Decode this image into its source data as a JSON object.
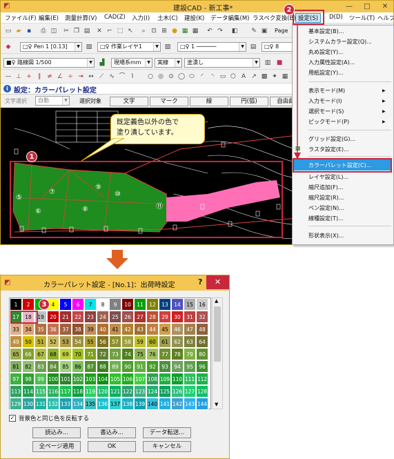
{
  "app": {
    "title": "建設CAD - 新工事*",
    "controls": [
      "—",
      "□",
      "✕"
    ]
  },
  "menu": [
    {
      "label": "ファイル(F)",
      "name": "menu-file"
    },
    {
      "label": "編集(E)",
      "name": "menu-edit"
    },
    {
      "label": "測量計算(V)",
      "name": "menu-survey"
    },
    {
      "label": "CAD(Z)",
      "name": "menu-cad"
    },
    {
      "label": "入力(I)",
      "name": "menu-input"
    },
    {
      "label": "土木(C)",
      "name": "menu-civil"
    },
    {
      "label": "建設(K)",
      "name": "menu-construction"
    },
    {
      "label": "データ編集(M)",
      "name": "menu-data-edit"
    },
    {
      "label": "ラスベク変換(B)",
      "name": "menu-raster"
    },
    {
      "label": "設定(S)",
      "name": "menu-settings"
    },
    {
      "label": "D(D)",
      "name": "menu-d"
    },
    {
      "label": "ツール(T)",
      "name": "menu-tools"
    },
    {
      "label": "ヘルプ",
      "name": "menu-help"
    }
  ],
  "toolbar": {
    "page_label": "Page",
    "pen_combo": "Pen 1 [0.13]",
    "layer_combo": "作業レイヤ1",
    "line_combo": "1 ──────",
    "num_combo": "8",
    "sheet_combo": "路線図 1/500",
    "scale_combo": "現場系mm",
    "mode_combo": "実線",
    "fill_combo": "塗潰し"
  },
  "command": {
    "title": "設定：カラーパレット設定",
    "text_select_label": "文字選択",
    "auto_label": "自動",
    "target_label": "選択対象",
    "buttons": [
      "文字",
      "マーク",
      "線",
      "円(弧)",
      "自由曲"
    ]
  },
  "settings_menu": {
    "items": [
      {
        "label": "基本設定(B)...",
        "arrow": false
      },
      {
        "label": "システムカラー設定(Q)...",
        "arrow": false
      },
      {
        "label": "丸め設定(Y)...",
        "arrow": false
      },
      {
        "label": "入力属性設定(A)...",
        "arrow": false
      },
      {
        "label": "用紙設定(Y)...",
        "arrow": false
      },
      {
        "label": "表示モード(M)",
        "arrow": true
      },
      {
        "label": "入力モード(I)",
        "arrow": true
      },
      {
        "label": "選択モード(S)",
        "arrow": true
      },
      {
        "label": "ピックモード(P)",
        "arrow": true
      },
      {
        "label": "グリッド設定(G)...",
        "arrow": false
      },
      {
        "label": "ラスタ設定(E)...",
        "arrow": false
      },
      {
        "label": "カラーパレット設定(C)...",
        "arrow": false,
        "highlight": true
      },
      {
        "label": "レイヤ設定(L)...",
        "arrow": false
      },
      {
        "label": "縮尺追加(F)...",
        "arrow": false
      },
      {
        "label": "縮尺設定(R)...",
        "arrow": false
      },
      {
        "label": "ペン設定(N)...",
        "arrow": false
      },
      {
        "label": "線種設定(T)...",
        "arrow": false
      },
      {
        "label": "形状表示(X)...",
        "arrow": false
      }
    ]
  },
  "callout": {
    "text_line1": "既定義色以外の色で",
    "text_line2": "塗り潰しています。"
  },
  "badges": {
    "one": "1",
    "two": "2",
    "three": "3"
  },
  "lot_numbers": [
    "⑦",
    "⑨",
    "⑥",
    "⑤",
    "⑧",
    "⑩",
    "⑪"
  ],
  "dialog": {
    "title": "カラーパレット設定 - [No.1]：出荷時設定",
    "help": "?",
    "close": "✕",
    "checkbox_label": "背景色と同じ色を反転する",
    "buttons": {
      "load": "読込み...",
      "save": "書込み...",
      "transfer": "データ転送...",
      "apply_all": "全ページ適用",
      "ok": "OK",
      "cancel": "キャンセル"
    },
    "palette_rows": [
      {
        "numbers": [
          1,
          2,
          3,
          4,
          5,
          6,
          7,
          8,
          9,
          10,
          11,
          12,
          13,
          14,
          15,
          16
        ],
        "colors": [
          "#000000",
          "#d40000",
          "#00b400",
          "#ffff00",
          "#0000ff",
          "#ff00ff",
          "#00e5e5",
          "#ffffff",
          "#808080",
          "#800000",
          "#00a000",
          "#808000",
          "#004080",
          "#5050c0",
          "#b0b0b0",
          "#cccccc"
        ]
      },
      {
        "numbers": [
          17,
          18,
          19,
          20,
          21,
          22,
          23,
          24,
          25,
          26,
          27,
          28,
          29,
          30,
          31,
          32
        ],
        "colors": [
          "#2c8c2c",
          "#e8b8c8",
          "#c0c0c0",
          "#c80000",
          "#a03030",
          "#c04848",
          "#904040",
          "#a06050",
          "#805050",
          "#a05050",
          "#b03030",
          "#c05030",
          "#d04040",
          "#d02020",
          "#c04040",
          "#b05050"
        ]
      },
      {
        "numbers": [
          33,
          34,
          35,
          36,
          37,
          38,
          39,
          40,
          41,
          42,
          43,
          44,
          45,
          46,
          47,
          48
        ],
        "colors": [
          "#e0b090",
          "#e0a070",
          "#b07040",
          "#c07050",
          "#a06040",
          "#905030",
          "#c09060",
          "#b07030",
          "#c09050",
          "#b08030",
          "#a07030",
          "#c08040",
          "#d0a050",
          "#b09060",
          "#a08050",
          "#906040"
        ]
      },
      {
        "numbers": [
          49,
          50,
          51,
          52,
          53,
          54,
          55,
          56,
          57,
          58,
          59,
          60,
          61,
          62,
          63,
          64
        ],
        "colors": [
          "#c09040",
          "#d8c000",
          "#c0b030",
          "#c8b860",
          "#b0a050",
          "#a09040",
          "#b0a030",
          "#807020",
          "#909030",
          "#a0a040",
          "#c0c030",
          "#b0b020",
          "#a0a050",
          "#909050",
          "#808040",
          "#707030"
        ]
      },
      {
        "numbers": [
          65,
          66,
          67,
          68,
          69,
          70,
          71,
          72,
          73,
          74,
          75,
          76,
          77,
          78,
          79,
          80
        ],
        "colors": [
          "#a0b050",
          "#80a030",
          "#b0c040",
          "#90b030",
          "#c0d040",
          "#a0c020",
          "#80a020",
          "#608030",
          "#70a040",
          "#508020",
          "#90b050",
          "#a0c060",
          "#709030",
          "#608020",
          "#80b040",
          "#609030"
        ]
      },
      {
        "numbers": [
          81,
          82,
          83,
          84,
          85,
          86,
          87,
          88,
          89,
          90,
          91,
          92,
          93,
          94,
          95,
          96
        ],
        "colors": [
          "#80b060",
          "#90c070",
          "#70a050",
          "#609040",
          "#a0d080",
          "#80c060",
          "#509030",
          "#408020",
          "#70b050",
          "#50a030",
          "#60b040",
          "#40a020",
          "#509040",
          "#70a060",
          "#60a050",
          "#409030"
        ]
      },
      {
        "numbers": [
          97,
          98,
          99,
          100,
          101,
          102,
          103,
          104,
          105,
          106,
          107,
          108,
          109,
          110,
          111,
          112
        ],
        "colors": [
          "#40b040",
          "#30a030",
          "#50c050",
          "#209020",
          "#308030",
          "#40a040",
          "#20a020",
          "#109010",
          "#30c030",
          "#20b020",
          "#40d040",
          "#30a050",
          "#20b040",
          "#10a030",
          "#30c060",
          "#20b050"
        ]
      },
      {
        "numbers": [
          113,
          114,
          115,
          116,
          117,
          118,
          119,
          120,
          121,
          122,
          123,
          124,
          125,
          126,
          127,
          128
        ],
        "colors": [
          "#30a060",
          "#20a050",
          "#40c070",
          "#30b060",
          "#20c050",
          "#10a040",
          "#30d060",
          "#20c070",
          "#10b060",
          "#30a070",
          "#40b080",
          "#20b070",
          "#10a060",
          "#30c080",
          "#20d070",
          "#10c060"
        ]
      },
      {
        "numbers": [
          129,
          130,
          131,
          132,
          133,
          134,
          135,
          136,
          137,
          138,
          139,
          140,
          141,
          142,
          143,
          144
        ],
        "colors": [
          "#40b090",
          "#30a0a0",
          "#20b0a0",
          "#30c0b0",
          "#20a0b0",
          "#30b0c0",
          "#40c0c0",
          "#20c0d0",
          "#30d0d0",
          "#20b0c0",
          "#10a0b0",
          "#30c0e0",
          "#20b0e0",
          "#40a0d0",
          "#30b0f0",
          "#20a0e0"
        ]
      }
    ]
  }
}
